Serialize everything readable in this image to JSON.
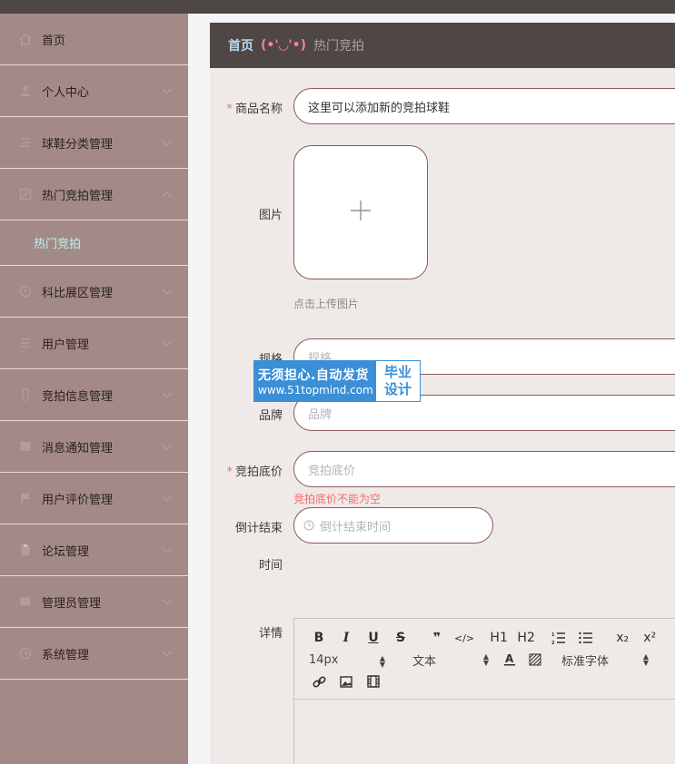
{
  "sidebar": {
    "items": [
      {
        "label": "首页",
        "icon": "home-icon"
      },
      {
        "label": "个人中心",
        "icon": "user-icon"
      },
      {
        "label": "球鞋分类管理",
        "icon": "list-icon"
      },
      {
        "label": "热门竞拍管理",
        "icon": "edit-icon",
        "expanded": true
      },
      {
        "label": "科比展区管理",
        "icon": "compass-icon"
      },
      {
        "label": "用户管理",
        "icon": "menu-icon"
      },
      {
        "label": "竞拍信息管理",
        "icon": "phone-icon"
      },
      {
        "label": "消息通知管理",
        "icon": "mail-icon"
      },
      {
        "label": "用户评价管理",
        "icon": "flag-icon"
      },
      {
        "label": "论坛管理",
        "icon": "clipboard-icon"
      },
      {
        "label": "管理员管理",
        "icon": "id-card-icon"
      },
      {
        "label": "系统管理",
        "icon": "clock-icon"
      }
    ],
    "submenu": {
      "label": "热门竞拍"
    }
  },
  "breadcrumb": {
    "home": "首页",
    "separator": "(•'◡'•)",
    "current": "热门竞拍"
  },
  "form": {
    "name": {
      "label": "商品名称",
      "value": "这里可以添加新的竞拍球鞋"
    },
    "image": {
      "label": "图片",
      "hint": "点击上传图片"
    },
    "spec": {
      "label": "规格",
      "placeholder": "规格"
    },
    "brand": {
      "label": "品牌",
      "placeholder": "品牌"
    },
    "reserve": {
      "label": "竞拍底价",
      "placeholder": "竞拍底价",
      "error": "竞拍底价不能为空"
    },
    "countdown": {
      "label_line1": "倒计结束",
      "label_line2": "时间",
      "placeholder": "倒计结束时间"
    },
    "details": {
      "label": "详情"
    }
  },
  "editor": {
    "toolbar_row1": [
      "B",
      "I",
      "U",
      "S",
      "❞",
      "</>",
      "H1",
      "H2",
      "ol",
      "ul",
      "x₂",
      "x²"
    ],
    "font_size": "14px",
    "block_type": "文本",
    "font_family": "标准字体"
  },
  "watermark": {
    "line1": "无须担心.自动发货",
    "line2": "www.51topmind.com",
    "right1": "毕业",
    "right2": "设计"
  },
  "colors": {
    "sidebar_bg": "#a38a87",
    "header_bg": "#4f4744",
    "submenu_active": "#b9f0f0",
    "input_border": "#8a5b58",
    "required": "#f56c6c",
    "watermark_blue": "#3a8fd6"
  }
}
